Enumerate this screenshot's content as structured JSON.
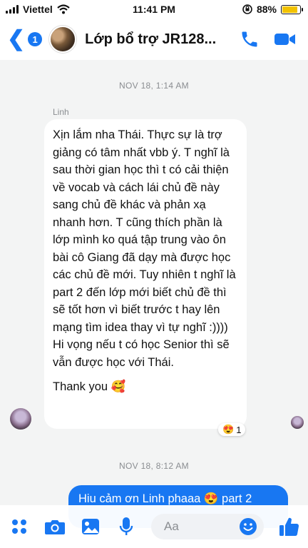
{
  "status_bar": {
    "carrier": "Viettel",
    "time": "11:41 PM",
    "battery": "88%",
    "battery_level": 0.88
  },
  "header": {
    "unread_count": "1",
    "title": "Lớp bổ trợ JR128..."
  },
  "messages": {
    "timestamp1": "NOV 18, 1:14 AM",
    "sender": "Linh",
    "body": "Xịn lắm nha Thái. Thực sự là trợ giảng có tâm nhất vbb ý. T nghĩ là sau thời gian học thì t có cải thiện về vocab và cách lái chủ đề này sang chủ đề khác và phản xạ nhanh hơn. T cũng thích phần là lớp mình ko quá tập trung vào ôn bài cô Giang đã dạy mà được học các chủ đề mới. Tuy nhiên t nghĩ là part 2 đến lớp mới biết chủ đề thì sẽ tốt hơn vì biết trước t hay lên mạng tìm idea thay vì tự nghĩ :))))",
    "body2": "Hi vọng nếu t có học Senior thì sẽ vẫn được học với Thái.",
    "thanks": "Thank you 🥰",
    "reaction_emoji": "😍",
    "reaction_count": "1",
    "timestamp2": "NOV 18, 8:12 AM",
    "outgoing_preview": "Hiu cảm ơn Linh phaaa 😍 part 2"
  },
  "composer": {
    "placeholder": "Aa"
  },
  "colors": {
    "accent": "#1877f2",
    "background": "#f3f4f4",
    "bubble_in": "#ffffff"
  }
}
